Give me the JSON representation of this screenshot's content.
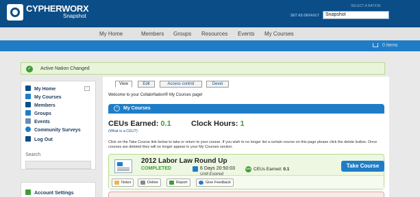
{
  "header": {
    "brand": "CYPHERWORX",
    "brand_sub": "Snapshot",
    "nation_label": "SELECT A NATION",
    "nation_default": "SET AS DEFAULT",
    "nation_value": "Snapshot"
  },
  "nav": {
    "items": [
      "My Home",
      "Members",
      "Groups",
      "Resources",
      "Events",
      "My Courses"
    ]
  },
  "cart": {
    "text": "0 items"
  },
  "alert": {
    "text": "Active Nation Changed"
  },
  "sidebar": {
    "items": [
      {
        "label": "My Home",
        "icon": "home-icon"
      },
      {
        "label": "My Courses",
        "icon": "monitor-icon"
      },
      {
        "label": "Members",
        "icon": "members-icon"
      },
      {
        "label": "Groups",
        "icon": "groups-icon"
      },
      {
        "label": "Events",
        "icon": "calendar-icon"
      },
      {
        "label": "Community Surveys",
        "icon": "survey-icon"
      },
      {
        "label": "Log Out",
        "icon": "logout-icon"
      }
    ],
    "search_label": "Search",
    "account": "Account Settings"
  },
  "tabs": [
    "View",
    "Edit",
    "Access control",
    "Devel"
  ],
  "welcome": "Welcome to your CollabrNation® My Courses page!",
  "panel": {
    "title": "My Courses"
  },
  "stats": {
    "ceus_label": "CEUs Earned:",
    "ceus_value": "0.1",
    "hours_label": "Clock Hours:",
    "hours_value": "1",
    "what_link": "(What is a CEU?)"
  },
  "instructions": "Click on the Take Course link below to take or return to your course. If you wish to no longer list a certain course on this page please click the delete button. Once courses are deleted they will no longer appear in your My Courses section.",
  "course": {
    "title": "2012 Labor Law Round Up",
    "status": "COMPLETED",
    "time_left": "6 Days 20:50:03",
    "until": "Until Expired",
    "ceu_badge": "CEU",
    "ceu_label": "CEUs Earned:",
    "ceu_value": "0.1",
    "take_button": "Take Course",
    "actions": [
      "Notes",
      "Delete",
      "Report",
      "Give Feedback"
    ]
  },
  "colors": {
    "header_bg": "#0b4d87",
    "accent_blue": "#1f7dc7",
    "success_green": "#3f9c35"
  }
}
